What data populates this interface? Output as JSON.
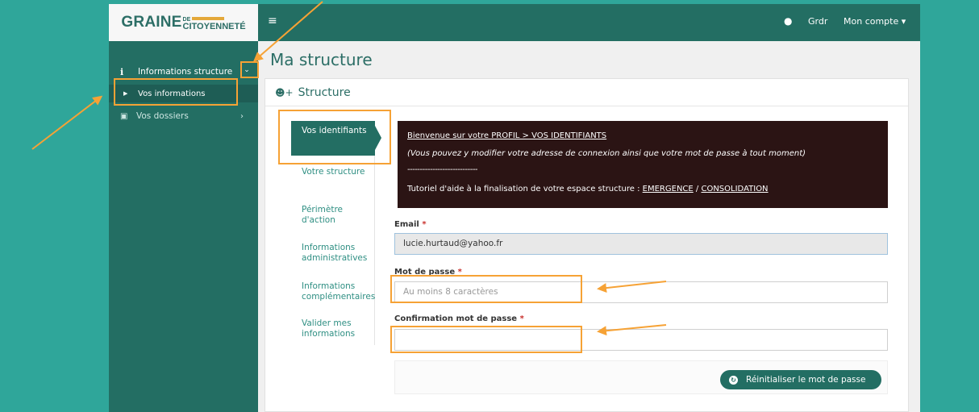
{
  "brand": {
    "logo_main": "GRAINE",
    "logo_de": "DE",
    "logo_sub": "CITOYENNETÉ"
  },
  "topbar": {
    "menu_icon": "hamburger-icon",
    "user_icon": "user-icon",
    "user_name": "Grdr",
    "account_label": "Mon compte ▾"
  },
  "sidebar": {
    "items": [
      {
        "label": "Informations structure",
        "icon": "info-icon"
      },
      {
        "label": "Vos informations",
        "icon": "caret-right-icon"
      },
      {
        "label": "Vos dossiers",
        "icon": "briefcase-icon"
      }
    ]
  },
  "page": {
    "title": "Ma structure",
    "panel_title": "Structure"
  },
  "tabs": [
    {
      "label": "Vos identifiants",
      "active": true
    },
    {
      "label": "Votre structure"
    },
    {
      "label": "Périmètre d'action"
    },
    {
      "label": "Informations administratives"
    },
    {
      "label": "Informations complémentaires"
    },
    {
      "label": "Valider mes informations"
    }
  ],
  "banner": {
    "line1": "Bienvenue sur votre PROFIL > VOS IDENTIFIANTS",
    "line2": "(Vous pouvez y modifier votre adresse de connexion ainsi que votre mot de passe à tout moment)",
    "line3": "----------------------------",
    "line4_text": "Tutoriel d'aide à la finalisation de votre espace structure : ",
    "link1": "EMERGENCE",
    "sep": " / ",
    "link2": "CONSOLIDATION"
  },
  "form": {
    "email_label": "Email",
    "email_value": "lucie.hurtaud@yahoo.fr",
    "password_label": "Mot de passe",
    "password_placeholder": "Au moins 8 caractères",
    "confirm_label": "Confirmation mot de passe",
    "required_mark": "*",
    "reset_button": "Réinitialiser le mot de passe"
  },
  "colors": {
    "background": "#2fa69a",
    "brand": "#236e63",
    "annotation": "#f6a235",
    "banner_bg": "#2b1414"
  }
}
